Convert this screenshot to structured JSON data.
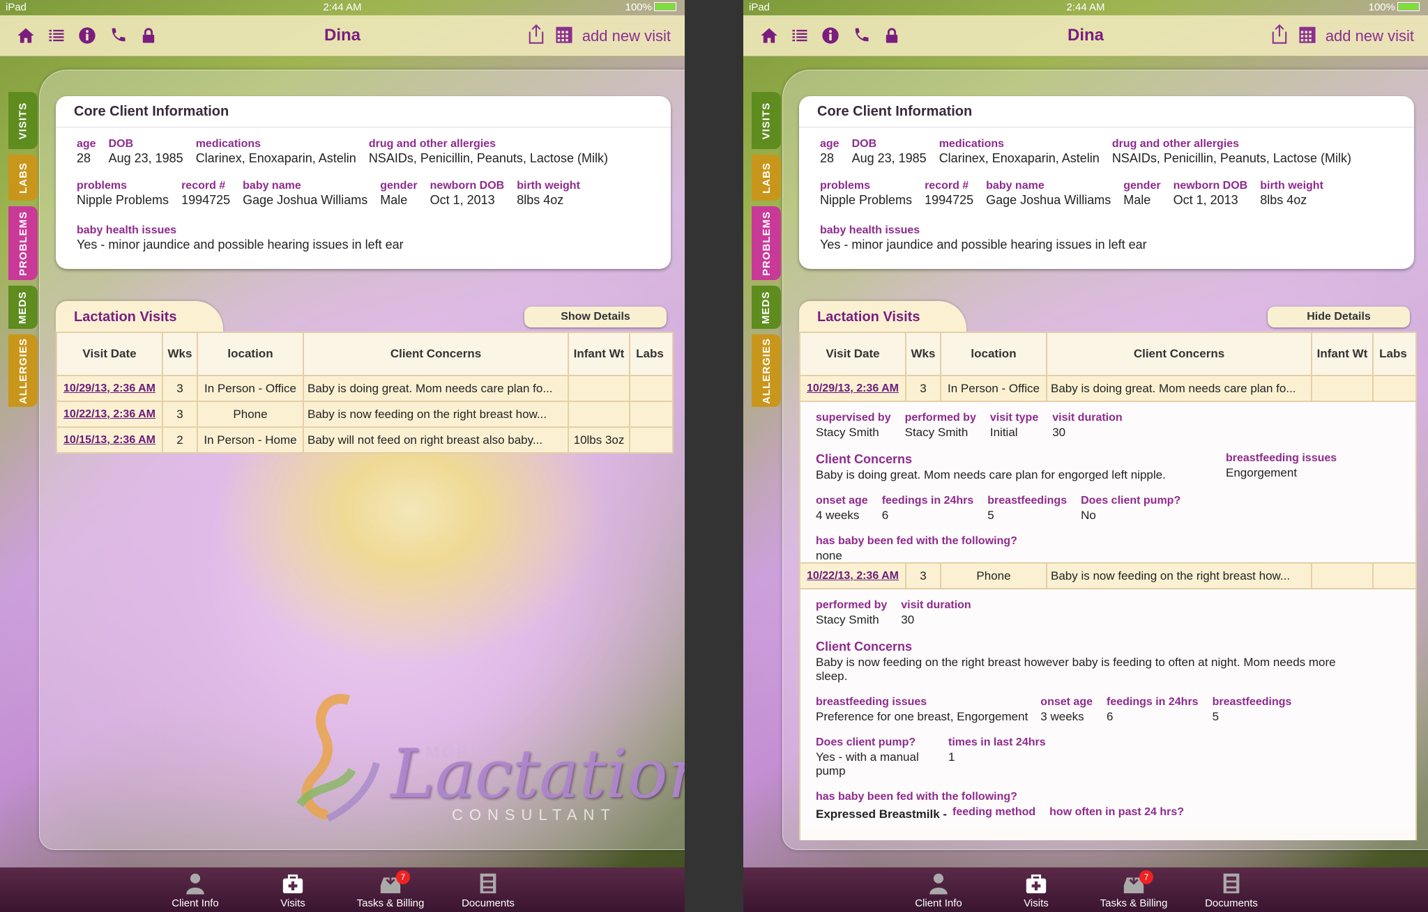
{
  "status": {
    "device": "iPad",
    "time": "2:44 AM",
    "battery": "100%"
  },
  "nav": {
    "title": "Dina",
    "add_visit": "add new visit"
  },
  "side_tabs": [
    {
      "label": "VISITS",
      "color": "#5e8c1f"
    },
    {
      "label": "LABS",
      "color": "#c9961c"
    },
    {
      "label": "PROBLEMS",
      "color": "#c93a98"
    },
    {
      "label": "MEDS",
      "color": "#5e8c1f"
    },
    {
      "label": "ALLERGIES",
      "color": "#c9961c"
    }
  ],
  "core": {
    "title": "Core Client Information",
    "age_label": "age",
    "age": "28",
    "dob_label": "DOB",
    "dob": "Aug 23, 1985",
    "meds_label": "medications",
    "meds": "Clarinex, Enoxaparin, Astelin",
    "allergies_label": "drug and other allergies",
    "allergies": "NSAIDs, Penicillin, Peanuts, Lactose (Milk)",
    "problems_label": "problems",
    "problems": "Nipple Problems",
    "record_label": "record #",
    "record": "1994725",
    "baby_name_label": "baby name",
    "baby_name": "Gage Joshua Williams",
    "gender_label": "gender",
    "gender": "Male",
    "newborn_dob_label": "newborn DOB",
    "newborn_dob": "Oct 1, 2013",
    "birth_weight_label": "birth weight",
    "birth_weight": "8lbs 4oz",
    "health_label": "baby health issues",
    "health": "Yes - minor jaundice and possible hearing issues in left ear"
  },
  "visits": {
    "title": "Lactation Visits",
    "show_details": "Show Details",
    "hide_details": "Hide Details",
    "columns": [
      "Visit Date",
      "Wks",
      "location",
      "Client Concerns",
      "Infant Wt",
      "Labs"
    ],
    "rows": [
      {
        "date": "10/29/13, 2:36 AM",
        "wks": "3",
        "location": "In Person - Office",
        "concerns": "Baby is doing great. Mom needs care plan fo...",
        "infant_wt": "",
        "labs": ""
      },
      {
        "date": "10/22/13, 2:36 AM",
        "wks": "3",
        "location": "Phone",
        "concerns": "Baby is now feeding on the right breast how...",
        "infant_wt": "",
        "labs": ""
      },
      {
        "date": "10/15/13, 2:36 AM",
        "wks": "2",
        "location": "In Person - Home",
        "concerns": "Baby will not feed on right breast also baby...",
        "infant_wt": "10lbs 3oz",
        "labs": ""
      }
    ],
    "detail1": {
      "supervised_label": "supervised by",
      "supervised": "Stacy Smith",
      "performed_label": "performed by",
      "performed": "Stacy Smith",
      "type_label": "visit type",
      "type": "Initial",
      "duration_label": "visit duration",
      "duration": "30",
      "concerns_label": "Client Concerns",
      "concerns": "Baby is doing great. Mom needs care plan for engorged left nipple.",
      "bf_issues_label": "breastfeeding issues",
      "bf_issues": "Engorgement",
      "onset_label": "onset age",
      "onset": "4 weeks",
      "feedings_label": "feedings in 24hrs",
      "feedings": "6",
      "bf_label": "breastfeedings",
      "bf": "5",
      "pump_label": "Does client pump?",
      "pump": "No",
      "fed_label": "has baby been fed with the following?",
      "fed": "none"
    },
    "detail2": {
      "performed_label": "performed by",
      "performed": "Stacy Smith",
      "duration_label": "visit duration",
      "duration": "30",
      "concerns_label": "Client Concerns",
      "concerns": "Baby is now feeding on the right breast however baby is feeding to often at night.  Mom needs more sleep.",
      "bf_issues_label": "breastfeeding issues",
      "bf_issues": "Preference for one breast, Engorgement",
      "onset_label": "onset age",
      "onset": "3 weeks",
      "feedings_label": "feedings in 24hrs",
      "feedings": "6",
      "bf_label": "breastfeedings",
      "bf": "5",
      "pump_label": "Does client pump?",
      "pump": "Yes - with a manual pump",
      "times_label": "times in last 24hrs",
      "times": "1",
      "fed_label": "has baby been fed with the following?",
      "fed_col1": "Expressed Breastmilk -",
      "fed_col2": "feeding method",
      "fed_col3": "how often in past 24 hrs?"
    }
  },
  "logo": {
    "mobile": "MOBILE",
    "lactation": "Lactation",
    "consultant": "CONSULTANT"
  },
  "tabbar": {
    "client_info": "Client Info",
    "visits": "Visits",
    "tasks": "Tasks & Billing",
    "tasks_badge": "7",
    "documents": "Documents"
  },
  "colors": {
    "accent": "#7a1d7f",
    "label": "#8e2b8e",
    "nav_bg": "#eee8ba",
    "row_bg": "#fbf1d2"
  }
}
